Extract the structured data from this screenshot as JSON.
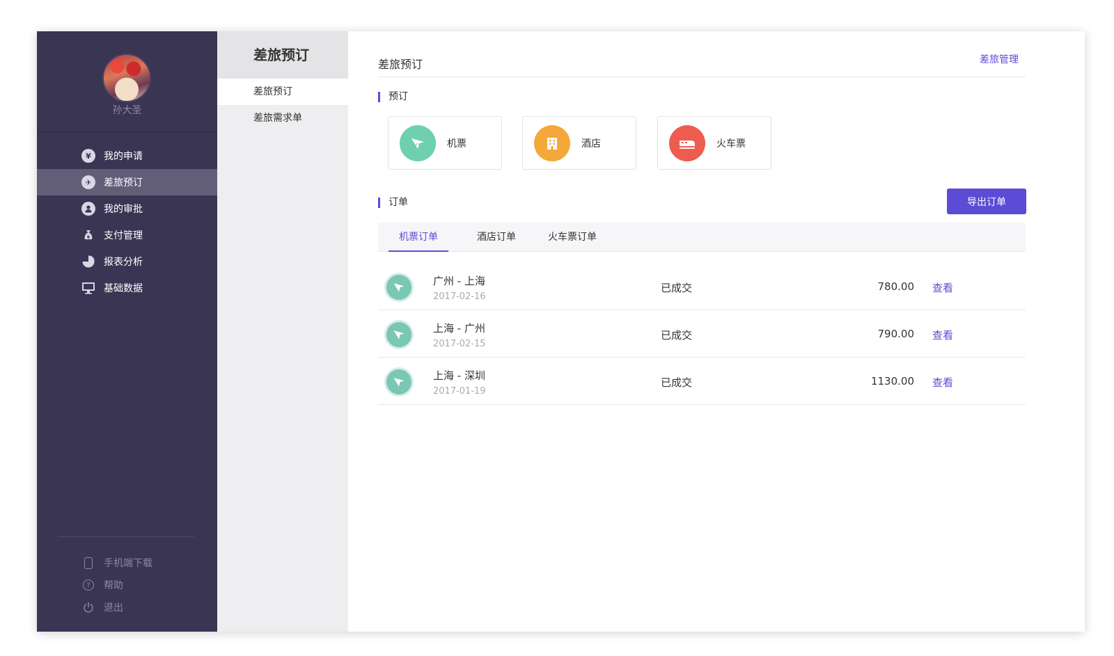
{
  "sidebar": {
    "username": "孙大圣",
    "items": [
      {
        "label": "我的申请",
        "icon": "yen-icon"
      },
      {
        "label": "差旅预订",
        "icon": "plane-icon"
      },
      {
        "label": "我的审批",
        "icon": "person-icon"
      },
      {
        "label": "支付管理",
        "icon": "money-bag-icon"
      },
      {
        "label": "报表分析",
        "icon": "pie-chart-icon"
      },
      {
        "label": "基础数据",
        "icon": "monitor-icon"
      }
    ],
    "active_index": 1,
    "bottom_links": [
      {
        "label": "手机端下载",
        "icon": "phone-icon"
      },
      {
        "label": "帮助",
        "icon": "help-icon"
      },
      {
        "label": "退出",
        "icon": "power-icon"
      }
    ]
  },
  "subnav": {
    "title": "差旅预订",
    "items": [
      {
        "label": "差旅预订"
      },
      {
        "label": "差旅需求单"
      }
    ],
    "active_index": 0
  },
  "main": {
    "page_title": "差旅预订",
    "header_link": "差旅管理",
    "booking_section": "预订",
    "booking_options": [
      {
        "label": "机票",
        "icon": "plane-icon",
        "color": "#6fd0ae"
      },
      {
        "label": "酒店",
        "icon": "hotel-icon",
        "color": "#f5a83a"
      },
      {
        "label": "火车票",
        "icon": "train-icon",
        "color": "#ee5b4f"
      }
    ],
    "orders_section": "订单",
    "export_button": "导出订单",
    "tabs": [
      {
        "label": "机票订单"
      },
      {
        "label": "酒店订单"
      },
      {
        "label": "火车票订单"
      }
    ],
    "active_tab": 0,
    "orders": [
      {
        "route": "广州 - 上海",
        "date": "2017-02-16",
        "status": "已成交",
        "price": "780.00",
        "action": "查看"
      },
      {
        "route": "上海 - 广州",
        "date": "2017-02-15",
        "status": "已成交",
        "price": "790.00",
        "action": "查看"
      },
      {
        "route": "上海 - 深圳",
        "date": "2017-01-19",
        "status": "已成交",
        "price": "1130.00",
        "action": "查看"
      }
    ]
  },
  "colors": {
    "sidebar_bg": "#3b3554",
    "accent": "#5b4bd5",
    "order_icon": "#7ac7b3"
  }
}
